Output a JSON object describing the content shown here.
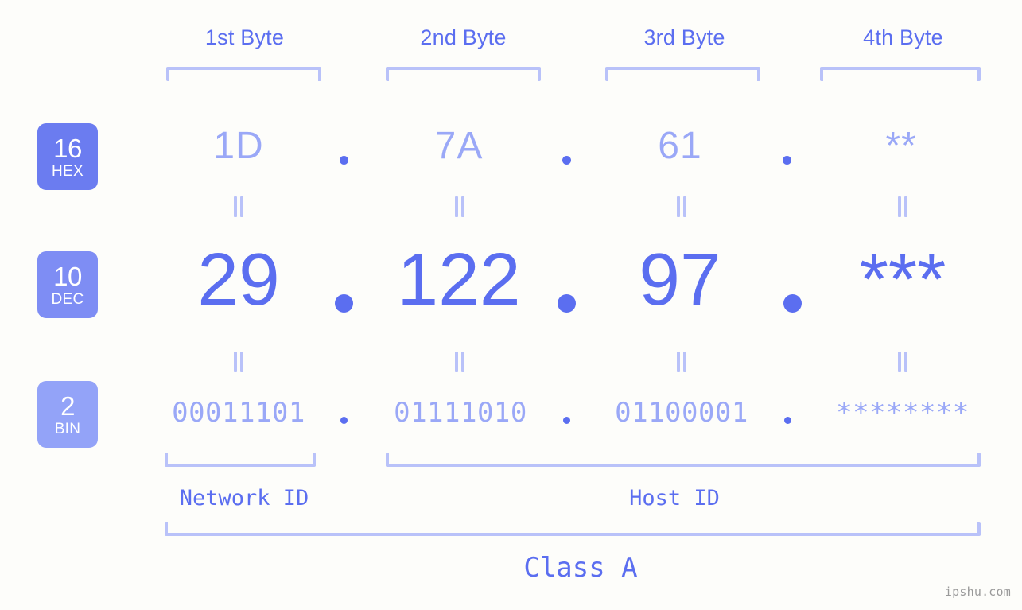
{
  "background_color": "#fdfdfa",
  "accent_color": "#5b6ef0",
  "muted_color": "#9aa8f7",
  "bracket_color": "#b9c2f9",
  "headers": {
    "byte1": "1st Byte",
    "byte2": "2nd Byte",
    "byte3": "3rd Byte",
    "byte4": "4th Byte"
  },
  "bases": {
    "hex": {
      "radix": "16",
      "abbr": "HEX",
      "color": "#6b7cf0"
    },
    "dec": {
      "radix": "10",
      "abbr": "DEC",
      "color": "#7e8df4"
    },
    "bin": {
      "radix": "2",
      "abbr": "BIN",
      "color": "#93a3f8"
    }
  },
  "rows": {
    "hex": {
      "b1": "1D",
      "b2": "7A",
      "b3": "61",
      "b4": "**"
    },
    "dec": {
      "b1": "29",
      "b2": "122",
      "b3": "97",
      "b4": "***"
    },
    "bin": {
      "b1": "00011101",
      "b2": "01111010",
      "b3": "01100001",
      "b4": "********"
    }
  },
  "separator": ".",
  "equality": "=",
  "footer": {
    "network_id": "Network ID",
    "host_id": "Host ID",
    "class": "Class A"
  },
  "watermark": "ipshu.com"
}
